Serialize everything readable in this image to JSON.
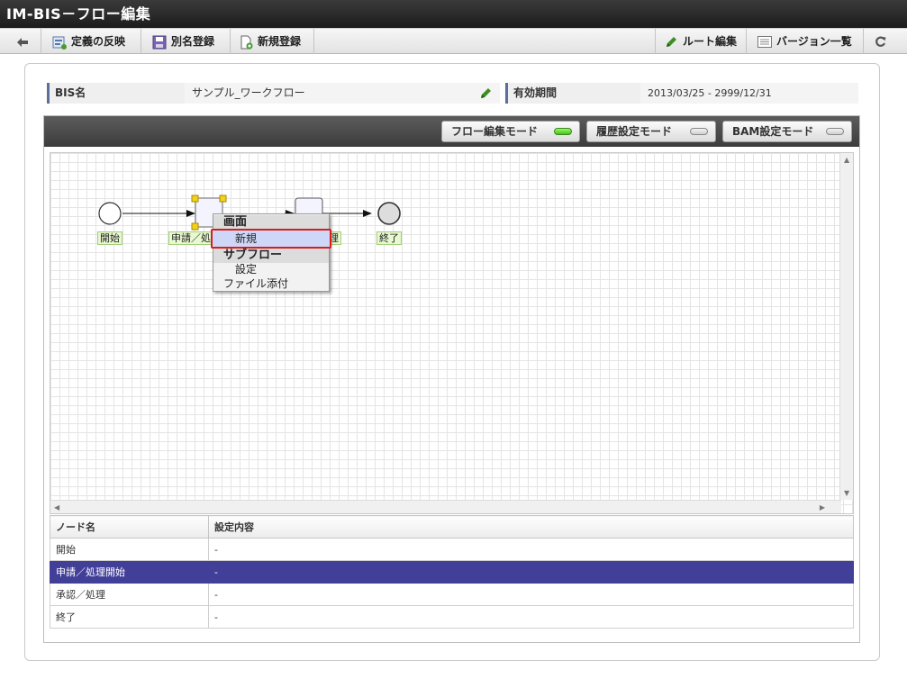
{
  "window": {
    "title": "IM-BIS－フロー編集"
  },
  "toolbar": {
    "back_icon": "arrow-left-icon",
    "apply_definition": "定義の反映",
    "save_as": "別名登録",
    "new_register": "新規登録",
    "route_edit": "ルート編集",
    "version_list": "バージョン一覧",
    "refresh_icon": "refresh-icon"
  },
  "info": {
    "bis_name_label": "BIS名",
    "bis_name_value": "サンプル_ワークフロー",
    "edit_icon": "pencil-icon",
    "period_label": "有効期間",
    "period_value": "2013/03/25 - 2999/12/31"
  },
  "modes": {
    "flow_edit": "フロー編集モード",
    "history": "履歴設定モード",
    "bam": "BAM設定モード",
    "active": "flow_edit"
  },
  "flow": {
    "start_label": "開始",
    "apply_label": "申請／処",
    "approve_label_tail": "理",
    "end_label": "終了"
  },
  "context_menu": {
    "section_screen": "画面",
    "item_new": "新規",
    "section_subflow": "サブフロー",
    "item_setting": "設定",
    "item_attach": "ファイル添付"
  },
  "node_table": {
    "headers": [
      "ノード名",
      "設定内容"
    ],
    "rows": [
      {
        "name": "開始",
        "value": "-"
      },
      {
        "name": "申請／処理開始",
        "value": "-"
      },
      {
        "name": "承認／処理",
        "value": "-"
      },
      {
        "name": "終了",
        "value": "-"
      }
    ],
    "selected_index": 1
  },
  "colors": {
    "selected_row": "#423f99",
    "active_led": "#3fc41e",
    "highlight_border": "#d81d1d"
  }
}
